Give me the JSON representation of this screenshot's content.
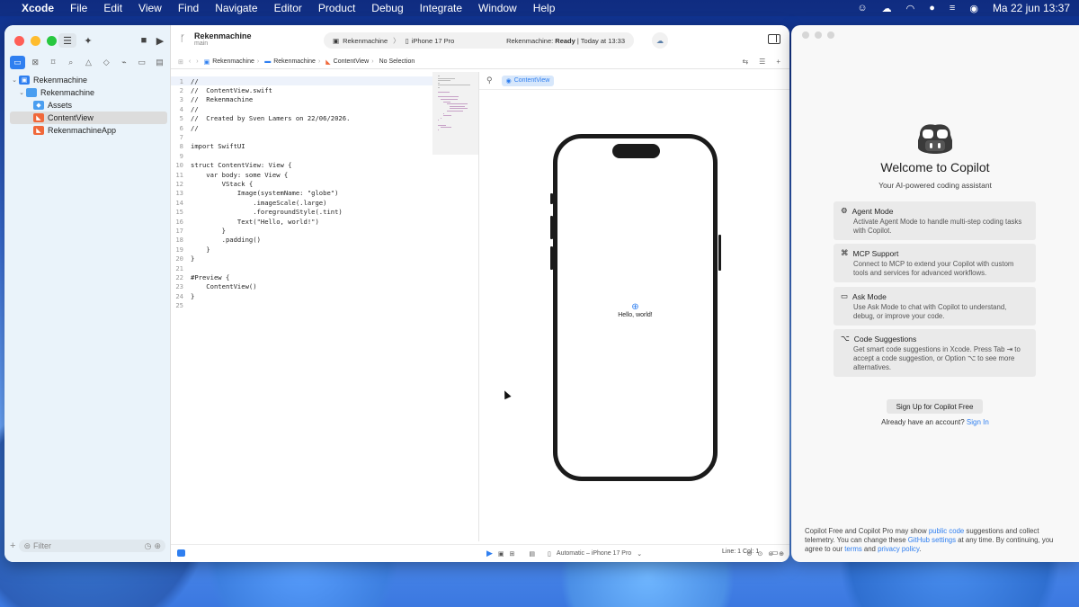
{
  "menubar": {
    "app": "Xcode",
    "items": [
      "File",
      "Edit",
      "View",
      "Find",
      "Navigate",
      "Editor",
      "Product",
      "Debug",
      "Integrate",
      "Window",
      "Help"
    ],
    "datetime": "Ma 22 jun  13:37"
  },
  "sidebar": {
    "tree": [
      {
        "label": "Rekenmachine",
        "icon": "xcodeproj-icon",
        "indent": 0,
        "chevron": "⌄"
      },
      {
        "label": "Rekenmachine",
        "icon": "folder-icon",
        "indent": 1,
        "chevron": "⌄"
      },
      {
        "label": "Assets",
        "icon": "assets-icon",
        "indent": 2,
        "chevron": ""
      },
      {
        "label": "ContentView",
        "icon": "swift-file-icon",
        "indent": 2,
        "chevron": "",
        "selected": true
      },
      {
        "label": "RekenmachineApp",
        "icon": "swift-file-icon",
        "indent": 2,
        "chevron": ""
      }
    ],
    "filter_placeholder": "Filter"
  },
  "toolbar": {
    "project_name": "Rekenmachine",
    "branch": "main",
    "scheme": "Rekenmachine",
    "destination": "iPhone 17 Pro",
    "status_prefix": "Rekenmachine: ",
    "status_state": "Ready",
    "status_time": " | Today at 13:33"
  },
  "jumpbar": {
    "segments": [
      "Rekenmachine",
      "Rekenmachine",
      "ContentView",
      "No Selection"
    ]
  },
  "code_lines": [
    "//",
    "//  ContentView.swift",
    "//  Rekenmachine",
    "//",
    "//  Created by Sven Lamers on 22/06/2026.",
    "//",
    "",
    "import SwiftUI",
    "",
    "struct ContentView: View {",
    "    var body: some View {",
    "        VStack {",
    "            Image(systemName: \"globe\")",
    "                .imageScale(.large)",
    "                .foregroundStyle(.tint)",
    "            Text(\"Hello, world!\")",
    "        }",
    "        .padding()",
    "    }",
    "}",
    "",
    "#Preview {",
    "    ContentView()",
    "}",
    ""
  ],
  "preview": {
    "tab_label": "ContentView",
    "hello_text": "Hello, world!",
    "device_label": "Automatic – iPhone 17 Pro"
  },
  "statusbar": {
    "line_col": "Line: 1  Col: 1"
  },
  "copilot": {
    "title": "Welcome to Copilot",
    "subtitle": "Your AI-powered coding assistant",
    "cards": [
      {
        "title": "Agent Mode",
        "icon": "agent-icon",
        "desc": "Activate Agent Mode to handle multi-step coding tasks with Copilot."
      },
      {
        "title": "MCP Support",
        "icon": "mcp-icon",
        "desc": "Connect to MCP to extend your Copilot with custom tools and services for advanced workflows."
      },
      {
        "title": "Ask Mode",
        "icon": "chat-icon",
        "desc": "Use Ask Mode to chat with Copilot to understand, debug, or improve your code."
      },
      {
        "title": "Code Suggestions",
        "icon": "option-key-icon",
        "desc": "Get smart code suggestions in Xcode. Press Tab ⇥ to accept a code suggestion, or Option ⌥ to see more alternatives."
      }
    ],
    "signup_label": "Sign Up for Copilot Free",
    "already_text": "Already have an account?",
    "signin_label": "Sign In",
    "footer": {
      "p1": "Copilot Free and Copilot Pro may show ",
      "l1": "public code",
      "p2": " suggestions and collect telemetry. You can change these ",
      "l2": "GitHub settings",
      "p3": " at any time. By continuing, you agree to our ",
      "l3": "terms",
      "p4": " and ",
      "l4": "privacy policy",
      "p5": "."
    }
  }
}
